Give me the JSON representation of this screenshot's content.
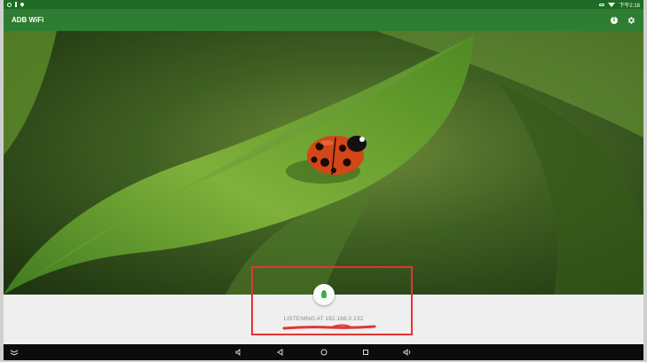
{
  "status_bar": {
    "time": "下午2:18",
    "left_icons": [
      "sync-icon",
      "usb-icon",
      "location-icon"
    ],
    "right_icons": [
      "vpn-key-icon",
      "wifi-icon"
    ]
  },
  "app_bar": {
    "title": "ADB WiFi",
    "info_icon": "info-icon",
    "settings_icon": "settings-gear-icon"
  },
  "status_panel": {
    "listening_text": "LISTENING AT 192.168.0.132",
    "fab_icon": "android-bug-icon"
  },
  "annotation": {
    "box_color": "#e23535",
    "underline_color": "#e23535"
  },
  "nav_bar": {
    "buttons": [
      "menu-collapse-icon",
      "volume-down-icon",
      "back-icon",
      "home-icon",
      "recents-icon",
      "volume-up-icon"
    ]
  },
  "colors": {
    "status_bar": "#1f6b25",
    "app_bar": "#2e7d32",
    "panel": "#efefef",
    "nav_bar": "#0c0c0c"
  }
}
